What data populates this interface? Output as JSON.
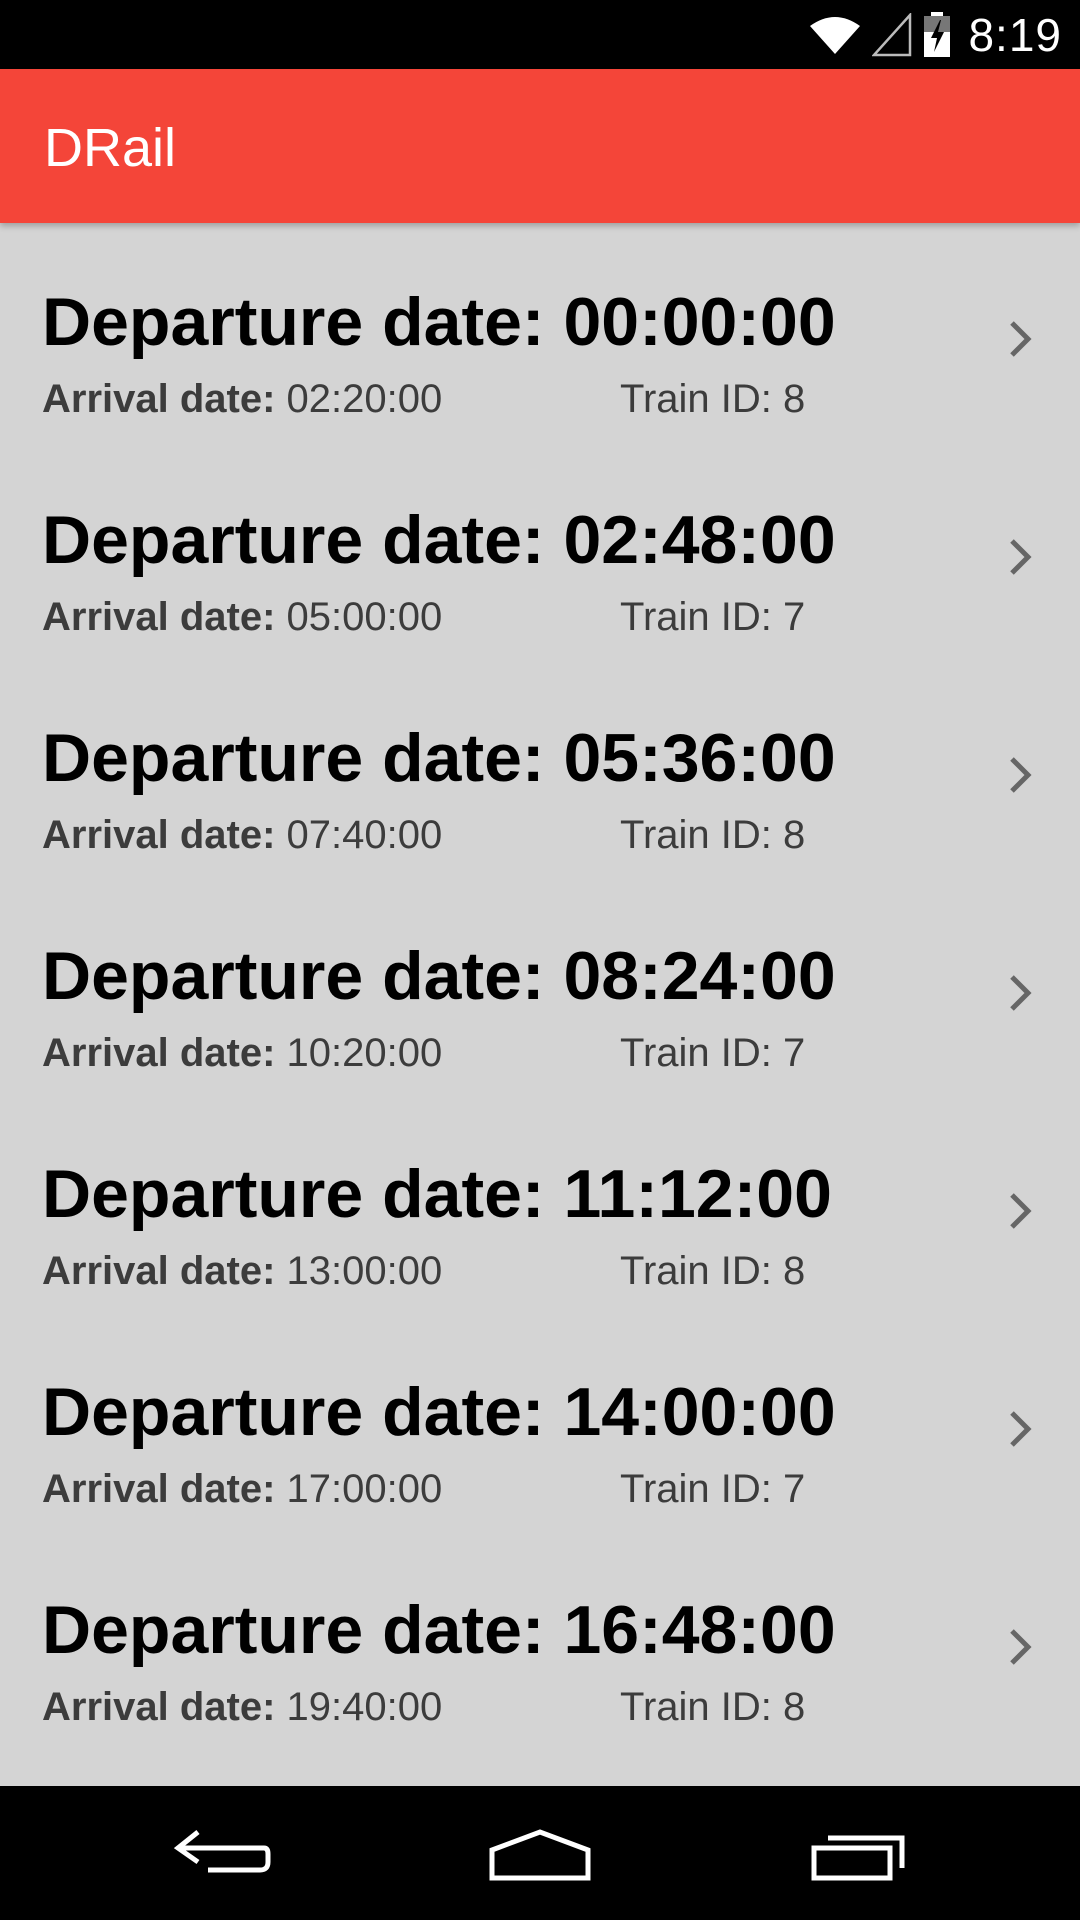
{
  "status_bar": {
    "time": "8:19",
    "icons": [
      "wifi-icon",
      "signal-icon",
      "battery-charging-icon"
    ]
  },
  "app_bar": {
    "title": "DRail",
    "color": "#f44539"
  },
  "trips": [
    {
      "departure": "Departure date: 00:00:00",
      "arrival_label": "Arrival date:",
      "arrival_time": "02:20:00",
      "train": "Train ID: 8"
    },
    {
      "departure": "Departure date: 02:48:00",
      "arrival_label": "Arrival date:",
      "arrival_time": "05:00:00",
      "train": "Train ID: 7"
    },
    {
      "departure": "Departure date: 05:36:00",
      "arrival_label": "Arrival date:",
      "arrival_time": "07:40:00",
      "train": "Train ID: 8"
    },
    {
      "departure": "Departure date: 08:24:00",
      "arrival_label": "Arrival date:",
      "arrival_time": "10:20:00",
      "train": "Train ID: 7"
    },
    {
      "departure": "Departure date: 11:12:00",
      "arrival_label": "Arrival date:",
      "arrival_time": "13:00:00",
      "train": "Train ID: 8"
    },
    {
      "departure": "Departure date: 14:00:00",
      "arrival_label": "Arrival date:",
      "arrival_time": "17:00:00",
      "train": "Train ID: 7"
    },
    {
      "departure": "Departure date: 16:48:00",
      "arrival_label": "Arrival date:",
      "arrival_time": "19:40:00",
      "train": "Train ID: 8"
    }
  ],
  "nav_bar": {
    "buttons": [
      "back-icon",
      "home-icon",
      "recents-icon"
    ]
  }
}
